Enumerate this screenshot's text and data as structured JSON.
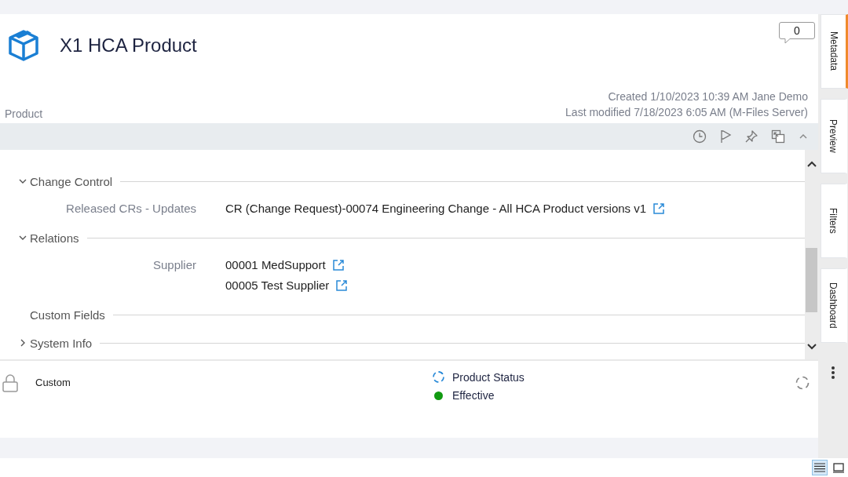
{
  "object": {
    "title": "X1 HCA Product",
    "class": "Product",
    "comment_count": "0",
    "created": "Created 1/10/2023 10:39 AM Jane Demo",
    "modified": "Last modified 7/18/2023 6:05 AM (M-Files Server)"
  },
  "sections": [
    {
      "title": "Change Control",
      "kind": "collapsible",
      "expanded": true,
      "properties": [
        {
          "label": "Released CRs - Updates",
          "values": [
            "CR (Change Request)-00074 Engineering Change - All HCA Product versions v1"
          ]
        }
      ]
    },
    {
      "title": "Relations",
      "kind": "collapsible",
      "expanded": true,
      "properties": [
        {
          "label": "Supplier",
          "values": [
            "00001 MedSupport",
            "00005 Test Supplier"
          ]
        }
      ]
    },
    {
      "title": "Custom Fields",
      "kind": "plain"
    },
    {
      "title": "System Info",
      "kind": "collapsible",
      "expanded": false
    }
  ],
  "footer": {
    "permissions": "Custom",
    "workflow": "Product Status",
    "state": "Effective"
  },
  "rail_tabs": [
    {
      "label": "Metadata",
      "selected": true
    },
    {
      "label": "Preview",
      "selected": false
    },
    {
      "label": "Filters",
      "selected": false
    },
    {
      "label": "Dashboard",
      "selected": false
    }
  ],
  "view_buttons": [
    {
      "kind": "list",
      "selected": true
    },
    {
      "kind": "preview",
      "selected": false
    }
  ]
}
